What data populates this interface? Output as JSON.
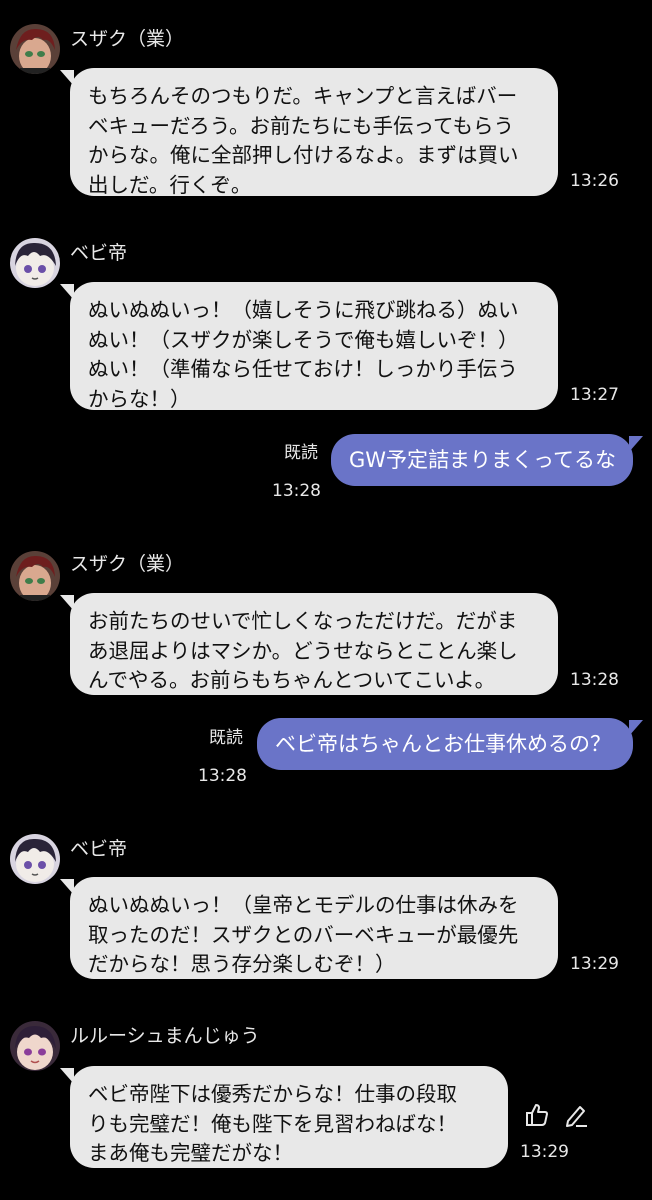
{
  "messages": [
    {
      "sender": "スザク（業）",
      "avatar_icon": "suzaku-avatar",
      "lines": [
        "もちろんそのつもりだ。キャンプと言えばバー",
        "ベキューだろう。お前たちにも手伝ってもらう",
        "からな。俺に全部押し付けるなよ。まずは買い",
        "出しだ。行くぞ。"
      ],
      "time": "13:26"
    },
    {
      "sender": "ベビ帝",
      "avatar_icon": "bebitei-avatar",
      "lines": [
        "ぬいぬぬいっ！（嬉しそうに飛び跳ねる）ぬい",
        "ぬい！（スザクが楽しそうで俺も嬉しいぞ！）",
        "ぬい！（準備なら任せておけ！しっかり手伝う",
        "からな！）"
      ],
      "time": "13:27"
    },
    {
      "text": "GW予定詰まりまくってるな",
      "read": "既読",
      "time": "13:28"
    },
    {
      "sender": "スザク（業）",
      "avatar_icon": "suzaku-avatar",
      "lines": [
        "お前たちのせいで忙しくなっただけだ。だがま",
        "あ退屈よりはマシか。どうせならとことん楽し",
        "んでやる。お前らもちゃんとついてこいよ。"
      ],
      "time": "13:28"
    },
    {
      "text": "ベビ帝はちゃんとお仕事休めるの？",
      "read": "既読",
      "time": "13:28"
    },
    {
      "sender": "ベビ帝",
      "avatar_icon": "bebitei-avatar",
      "lines": [
        "ぬいぬぬいっ！（皇帝とモデルの仕事は休みを",
        "取ったのだ！スザクとのバーベキューが最優先",
        "だからな！思う存分楽しむぞ！）"
      ],
      "time": "13:29"
    },
    {
      "sender": "ルルーシュまんじゅう",
      "avatar_icon": "lelouch-avatar",
      "lines": [
        "ベビ帝陛下は優秀だからな！仕事の段取",
        "りも完璧だ！俺も陛下を見習わねばな！",
        "まあ俺も完璧だがな！"
      ],
      "time": "13:29",
      "actions": [
        "thumbs-up-icon",
        "edit-pencil-icon"
      ]
    }
  ],
  "colors": {
    "background": "#000000",
    "incoming_bubble": "#e8e8e8",
    "outgoing_bubble": "#6a74c8"
  }
}
